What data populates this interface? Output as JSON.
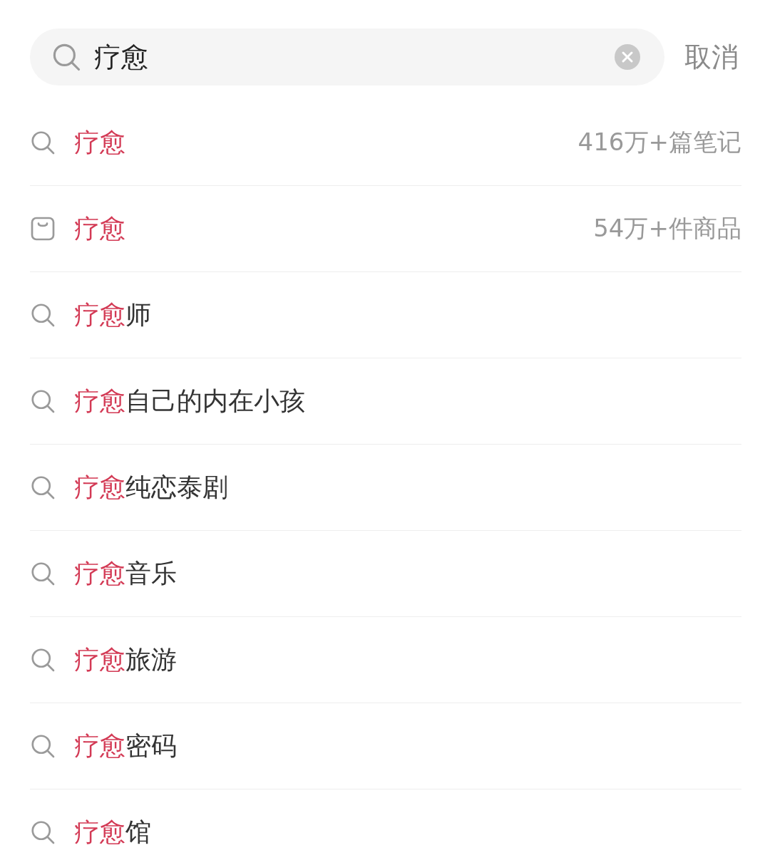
{
  "search": {
    "value": "疗愈",
    "cancel": "取消"
  },
  "suggestions": [
    {
      "kind": "search",
      "match": "疗愈",
      "count": "416万+篇笔记"
    },
    {
      "kind": "shop",
      "match": "疗愈",
      "count": "54万+件商品"
    },
    {
      "kind": "search",
      "match": "疗愈",
      "rest": "师"
    },
    {
      "kind": "search",
      "match": "疗愈",
      "rest": "自己的内在小孩"
    },
    {
      "kind": "search",
      "match": "疗愈",
      "rest": "纯恋泰剧"
    },
    {
      "kind": "search",
      "match": "疗愈",
      "rest": "音乐"
    },
    {
      "kind": "search",
      "match": "疗愈",
      "rest": "旅游"
    },
    {
      "kind": "search",
      "match": "疗愈",
      "rest": "密码"
    },
    {
      "kind": "search",
      "match": "疗愈",
      "rest": "馆"
    }
  ]
}
